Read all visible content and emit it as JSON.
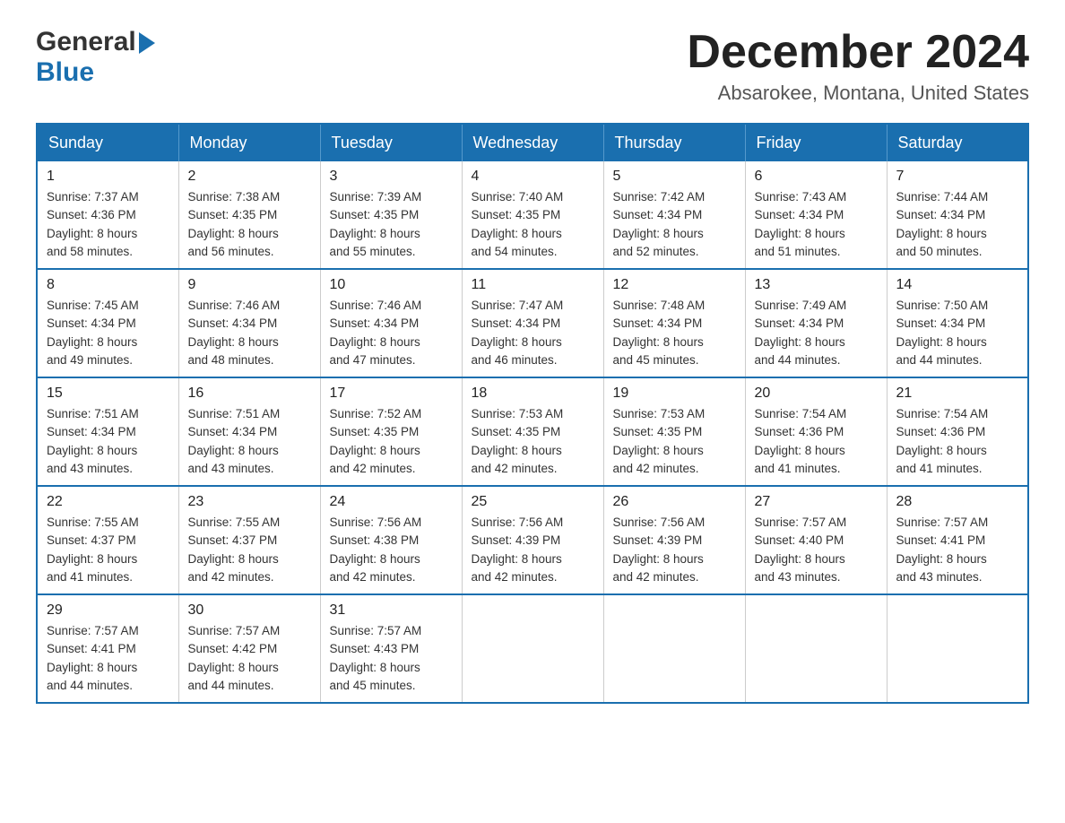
{
  "header": {
    "logo_general": "General",
    "logo_blue": "Blue",
    "month_title": "December 2024",
    "location": "Absarokee, Montana, United States"
  },
  "days_of_week": [
    "Sunday",
    "Monday",
    "Tuesday",
    "Wednesday",
    "Thursday",
    "Friday",
    "Saturday"
  ],
  "weeks": [
    [
      {
        "day": "1",
        "sunrise": "7:37 AM",
        "sunset": "4:36 PM",
        "daylight": "8 hours and 58 minutes."
      },
      {
        "day": "2",
        "sunrise": "7:38 AM",
        "sunset": "4:35 PM",
        "daylight": "8 hours and 56 minutes."
      },
      {
        "day": "3",
        "sunrise": "7:39 AM",
        "sunset": "4:35 PM",
        "daylight": "8 hours and 55 minutes."
      },
      {
        "day": "4",
        "sunrise": "7:40 AM",
        "sunset": "4:35 PM",
        "daylight": "8 hours and 54 minutes."
      },
      {
        "day": "5",
        "sunrise": "7:42 AM",
        "sunset": "4:34 PM",
        "daylight": "8 hours and 52 minutes."
      },
      {
        "day": "6",
        "sunrise": "7:43 AM",
        "sunset": "4:34 PM",
        "daylight": "8 hours and 51 minutes."
      },
      {
        "day": "7",
        "sunrise": "7:44 AM",
        "sunset": "4:34 PM",
        "daylight": "8 hours and 50 minutes."
      }
    ],
    [
      {
        "day": "8",
        "sunrise": "7:45 AM",
        "sunset": "4:34 PM",
        "daylight": "8 hours and 49 minutes."
      },
      {
        "day": "9",
        "sunrise": "7:46 AM",
        "sunset": "4:34 PM",
        "daylight": "8 hours and 48 minutes."
      },
      {
        "day": "10",
        "sunrise": "7:46 AM",
        "sunset": "4:34 PM",
        "daylight": "8 hours and 47 minutes."
      },
      {
        "day": "11",
        "sunrise": "7:47 AM",
        "sunset": "4:34 PM",
        "daylight": "8 hours and 46 minutes."
      },
      {
        "day": "12",
        "sunrise": "7:48 AM",
        "sunset": "4:34 PM",
        "daylight": "8 hours and 45 minutes."
      },
      {
        "day": "13",
        "sunrise": "7:49 AM",
        "sunset": "4:34 PM",
        "daylight": "8 hours and 44 minutes."
      },
      {
        "day": "14",
        "sunrise": "7:50 AM",
        "sunset": "4:34 PM",
        "daylight": "8 hours and 44 minutes."
      }
    ],
    [
      {
        "day": "15",
        "sunrise": "7:51 AM",
        "sunset": "4:34 PM",
        "daylight": "8 hours and 43 minutes."
      },
      {
        "day": "16",
        "sunrise": "7:51 AM",
        "sunset": "4:34 PM",
        "daylight": "8 hours and 43 minutes."
      },
      {
        "day": "17",
        "sunrise": "7:52 AM",
        "sunset": "4:35 PM",
        "daylight": "8 hours and 42 minutes."
      },
      {
        "day": "18",
        "sunrise": "7:53 AM",
        "sunset": "4:35 PM",
        "daylight": "8 hours and 42 minutes."
      },
      {
        "day": "19",
        "sunrise": "7:53 AM",
        "sunset": "4:35 PM",
        "daylight": "8 hours and 42 minutes."
      },
      {
        "day": "20",
        "sunrise": "7:54 AM",
        "sunset": "4:36 PM",
        "daylight": "8 hours and 41 minutes."
      },
      {
        "day": "21",
        "sunrise": "7:54 AM",
        "sunset": "4:36 PM",
        "daylight": "8 hours and 41 minutes."
      }
    ],
    [
      {
        "day": "22",
        "sunrise": "7:55 AM",
        "sunset": "4:37 PM",
        "daylight": "8 hours and 41 minutes."
      },
      {
        "day": "23",
        "sunrise": "7:55 AM",
        "sunset": "4:37 PM",
        "daylight": "8 hours and 42 minutes."
      },
      {
        "day": "24",
        "sunrise": "7:56 AM",
        "sunset": "4:38 PM",
        "daylight": "8 hours and 42 minutes."
      },
      {
        "day": "25",
        "sunrise": "7:56 AM",
        "sunset": "4:39 PM",
        "daylight": "8 hours and 42 minutes."
      },
      {
        "day": "26",
        "sunrise": "7:56 AM",
        "sunset": "4:39 PM",
        "daylight": "8 hours and 42 minutes."
      },
      {
        "day": "27",
        "sunrise": "7:57 AM",
        "sunset": "4:40 PM",
        "daylight": "8 hours and 43 minutes."
      },
      {
        "day": "28",
        "sunrise": "7:57 AM",
        "sunset": "4:41 PM",
        "daylight": "8 hours and 43 minutes."
      }
    ],
    [
      {
        "day": "29",
        "sunrise": "7:57 AM",
        "sunset": "4:41 PM",
        "daylight": "8 hours and 44 minutes."
      },
      {
        "day": "30",
        "sunrise": "7:57 AM",
        "sunset": "4:42 PM",
        "daylight": "8 hours and 44 minutes."
      },
      {
        "day": "31",
        "sunrise": "7:57 AM",
        "sunset": "4:43 PM",
        "daylight": "8 hours and 45 minutes."
      },
      null,
      null,
      null,
      null
    ]
  ],
  "labels": {
    "sunrise_prefix": "Sunrise: ",
    "sunset_prefix": "Sunset: ",
    "daylight_prefix": "Daylight: "
  }
}
